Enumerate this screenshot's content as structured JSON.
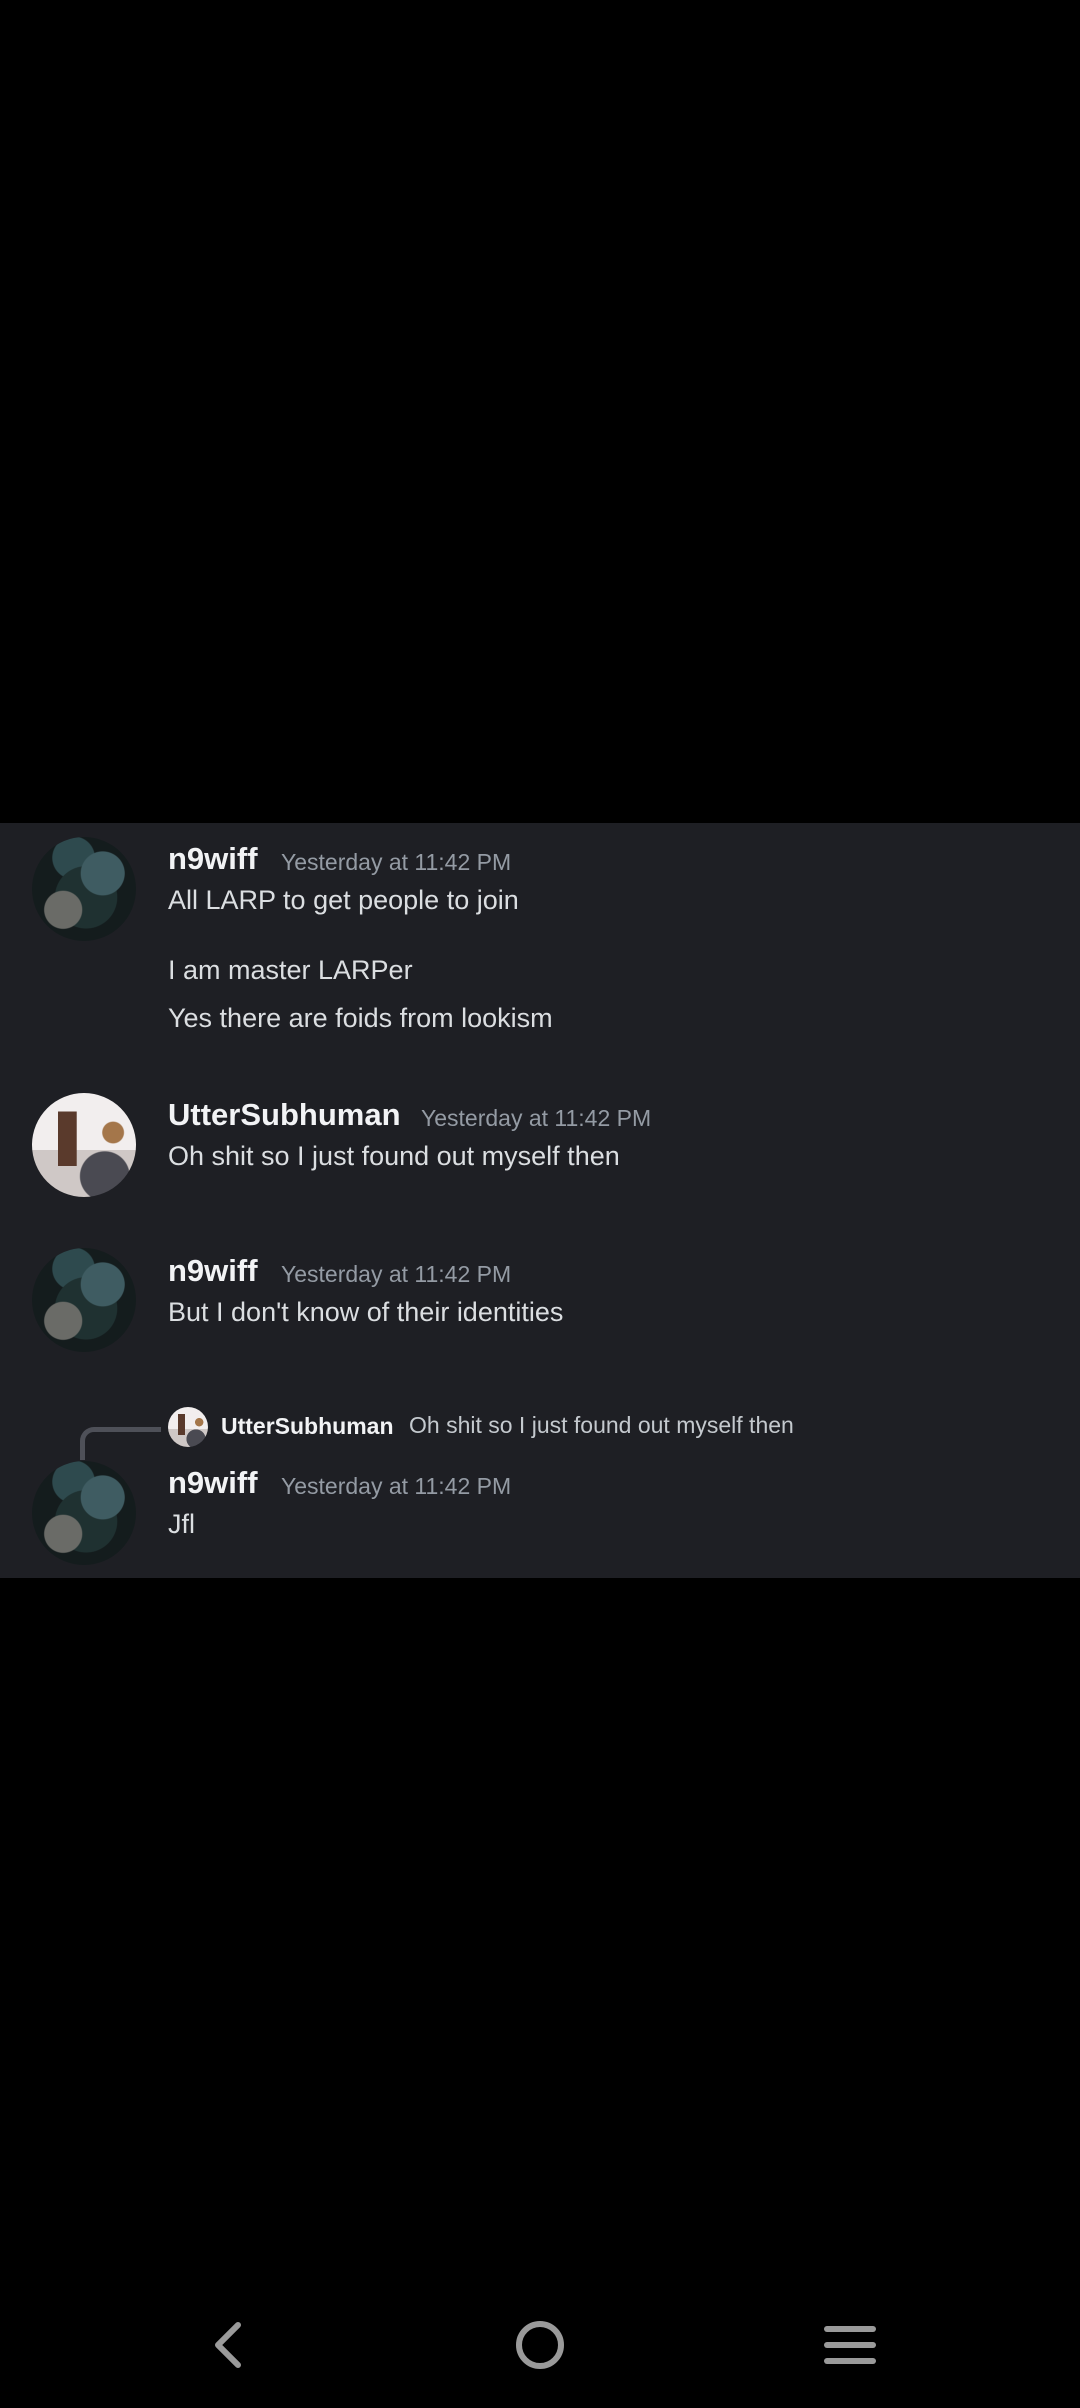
{
  "messages": [
    {
      "author": "n9wiff",
      "timestamp": "Yesterday at 11:42 PM",
      "lines": [
        "All LARP to get people to join",
        "I am master LARPer",
        "Yes there are foids from lookism"
      ]
    },
    {
      "author": "UtterSubhuman",
      "timestamp": "Yesterday at 11:42 PM",
      "lines": [
        "Oh shit so I just found out myself then"
      ]
    },
    {
      "author": "n9wiff",
      "timestamp": "Yesterday at 11:42 PM",
      "lines": [
        "But I don't know of their identities"
      ]
    },
    {
      "author": "n9wiff",
      "timestamp": "Yesterday at 11:42 PM",
      "reply_to": {
        "author": "UtterSubhuman",
        "text": "Oh shit so I just found out myself then"
      },
      "lines": [
        "Jfl"
      ]
    }
  ],
  "nav": {
    "back_icon": "chevron-left-icon",
    "home_icon": "circle-home-icon",
    "recents_icon": "menu-lines-icon"
  },
  "colors": {
    "panel_background": "#1e1f24",
    "screen_background": "#000000",
    "name_color": "#f2f3f5",
    "timestamp_color": "#949ba4",
    "text_color": "#dbdee1"
  }
}
